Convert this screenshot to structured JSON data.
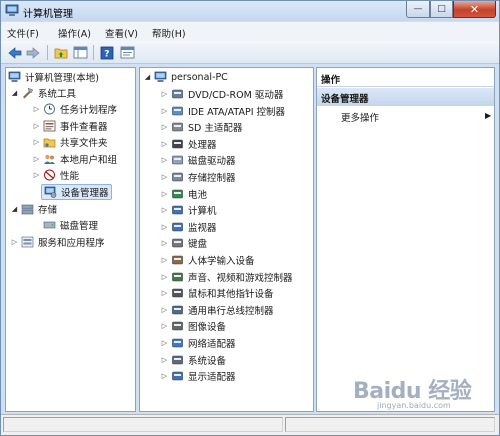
{
  "window": {
    "title": "计算机管理",
    "title_icon": "computer-management-icon",
    "buttons": {
      "minimize": "—",
      "maximize": "□",
      "close": "✕"
    }
  },
  "menu": [
    "文件(F)",
    "操作(A)",
    "查看(V)",
    "帮助(H)"
  ],
  "toolbar": [
    "back-arrow-icon",
    "forward-arrow-icon",
    "up-folder-icon",
    "show-hide-tree-icon",
    "help-icon",
    "properties-icon"
  ],
  "left_tree": [
    {
      "label": "计算机管理(本地)",
      "icon": "computer-management-icon",
      "expander": ""
    },
    {
      "label": "系统工具",
      "icon": "tools-icon",
      "expander": "◢"
    },
    {
      "label": "任务计划程序",
      "icon": "clock-icon",
      "expander": "▷"
    },
    {
      "label": "事件查看器",
      "icon": "event-viewer-icon",
      "expander": "▷"
    },
    {
      "label": "共享文件夹",
      "icon": "shared-folder-icon",
      "expander": "▷"
    },
    {
      "label": "本地用户和组",
      "icon": "users-icon",
      "expander": "▷"
    },
    {
      "label": "性能",
      "icon": "performance-icon",
      "expander": "▷"
    },
    {
      "label": "设备管理器",
      "icon": "device-manager-icon",
      "expander": ""
    },
    {
      "label": "存储",
      "icon": "storage-icon",
      "expander": "◢"
    },
    {
      "label": "磁盘管理",
      "icon": "disk-icon",
      "expander": ""
    },
    {
      "label": "服务和应用程序",
      "icon": "services-icon",
      "expander": "▷"
    }
  ],
  "device_tree": {
    "root": {
      "label": "personal-PC",
      "icon": "computer-icon",
      "expander": "◢"
    },
    "items": [
      {
        "label": "DVD/CD-ROM 驱动器",
        "icon": "dvd-drive-icon"
      },
      {
        "label": "IDE ATA/ATAPI 控制器",
        "icon": "ide-controller-icon"
      },
      {
        "label": "SD 主适配器",
        "icon": "sd-adapter-icon"
      },
      {
        "label": "处理器",
        "icon": "processor-icon"
      },
      {
        "label": "磁盘驱动器",
        "icon": "disk-drive-icon"
      },
      {
        "label": "存储控制器",
        "icon": "storage-controller-icon"
      },
      {
        "label": "电池",
        "icon": "battery-icon"
      },
      {
        "label": "计算机",
        "icon": "computer-icon"
      },
      {
        "label": "监视器",
        "icon": "monitor-icon"
      },
      {
        "label": "键盘",
        "icon": "keyboard-icon"
      },
      {
        "label": "人体学输入设备",
        "icon": "hid-icon"
      },
      {
        "label": "声音、视频和游戏控制器",
        "icon": "sound-icon"
      },
      {
        "label": "鼠标和其他指针设备",
        "icon": "mouse-icon"
      },
      {
        "label": "通用串行总线控制器",
        "icon": "usb-icon"
      },
      {
        "label": "图像设备",
        "icon": "imaging-icon"
      },
      {
        "label": "网络适配器",
        "icon": "network-adapter-icon"
      },
      {
        "label": "系统设备",
        "icon": "system-devices-icon"
      },
      {
        "label": "显示适配器",
        "icon": "display-adapter-icon"
      }
    ]
  },
  "actions": {
    "header": "操作",
    "group": "设备管理器",
    "more": "更多操作",
    "more_arrow": "▶"
  },
  "watermark": {
    "logo": "Baidu 经验",
    "sub": "jingyan.baidu.com"
  }
}
